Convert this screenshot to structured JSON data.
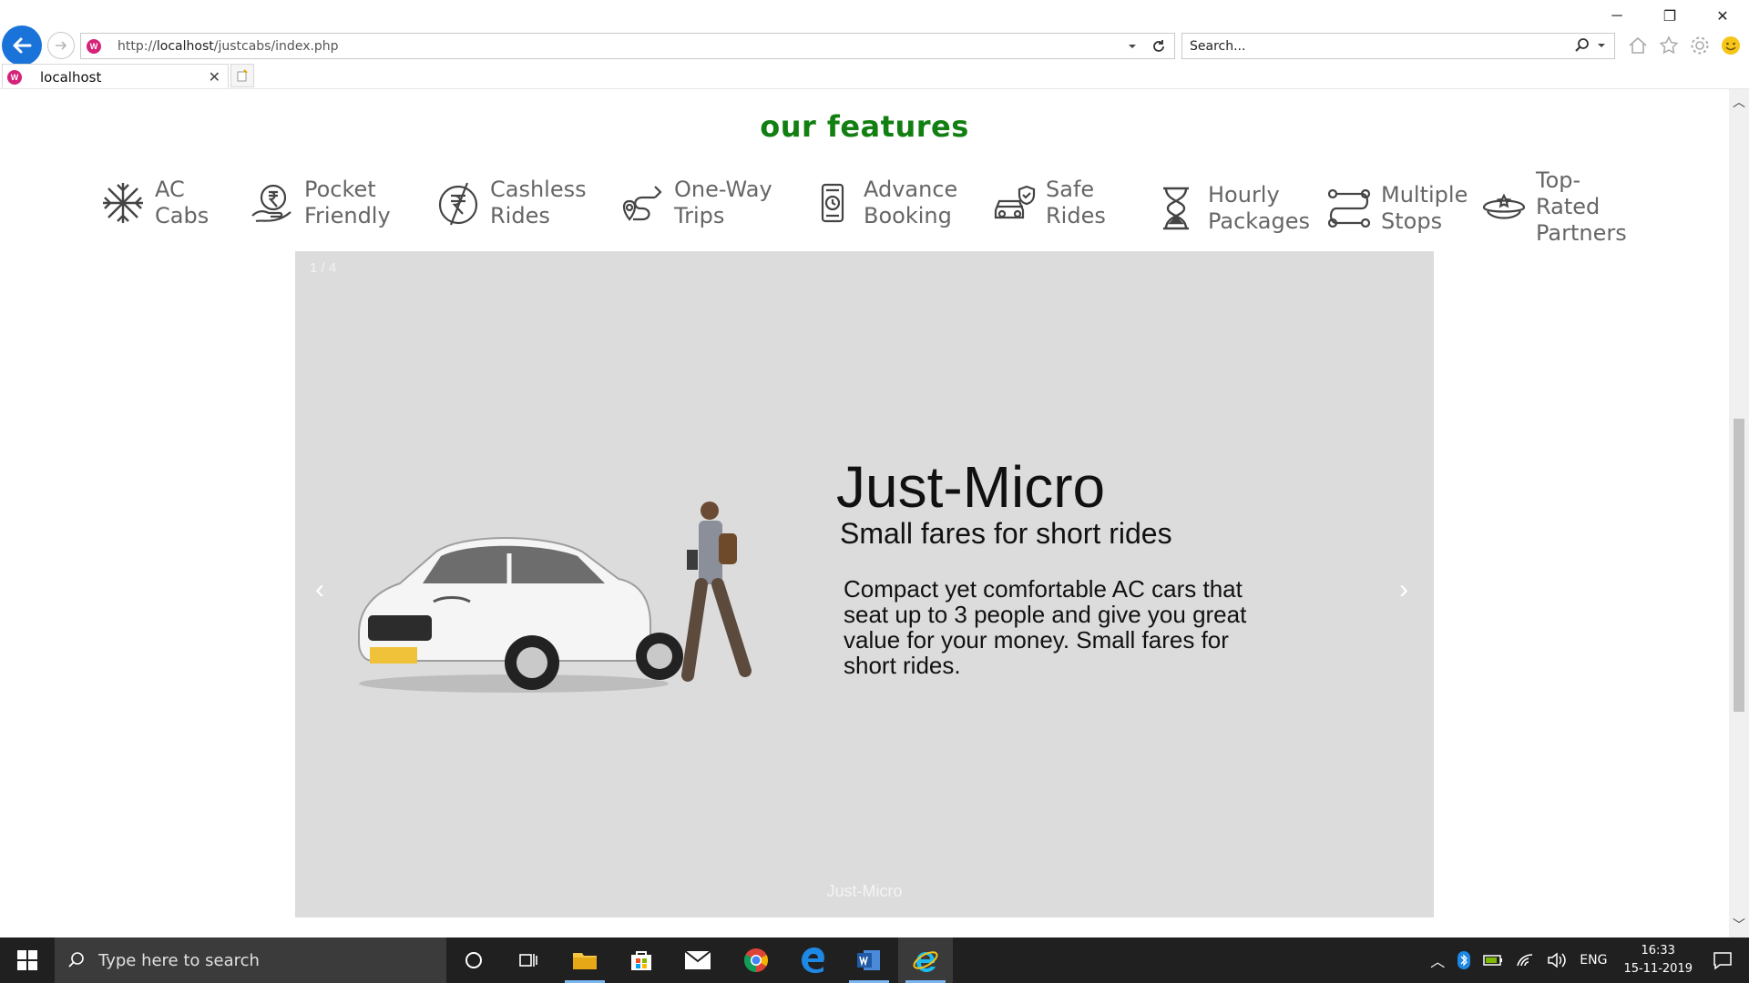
{
  "browser": {
    "url_prefix": "http://",
    "url_host": "localhost",
    "url_path": "/justcabs/index.php",
    "search_placeholder": "Search...",
    "tab_title": "localhost"
  },
  "page": {
    "section_title": "our features",
    "features": [
      {
        "icon": "snowflake-icon",
        "label": "AC\nCabs"
      },
      {
        "icon": "rupee-hand-icon",
        "label": "Pocket\nFriendly"
      },
      {
        "icon": "no-cash-icon",
        "label": "Cashless\nRides"
      },
      {
        "icon": "route-pin-icon",
        "label": "One-Way\nTrips"
      },
      {
        "icon": "phone-clock-icon",
        "label": "Advance\nBooking"
      },
      {
        "icon": "car-shield-icon",
        "label": "Safe\nRides"
      },
      {
        "icon": "hourglass-icon",
        "label": "Hourly\nPackages"
      },
      {
        "icon": "multi-stop-icon",
        "label": "Multiple\nStops"
      },
      {
        "icon": "chauffeur-cap-icon",
        "label": "Top-\nRated\nPartners"
      }
    ],
    "carousel": {
      "counter": "1 / 4",
      "heading": "Just-Micro",
      "subheading": "Small fares for short rides",
      "description": "Compact yet comfortable AC cars that seat up to 3 people and give you great value for your money. Small fares for short rides.",
      "caption": "Just-Micro",
      "prev": "‹",
      "next": "›"
    }
  },
  "taskbar": {
    "search_placeholder": "Type here to search",
    "language": "ENG",
    "time": "16:33",
    "date": "15-11-2019"
  },
  "colors": {
    "accent_green": "#127f12",
    "carousel_bg": "#dcdcdc",
    "browser_back": "#1a73d9",
    "taskbar_bg": "#202020"
  }
}
